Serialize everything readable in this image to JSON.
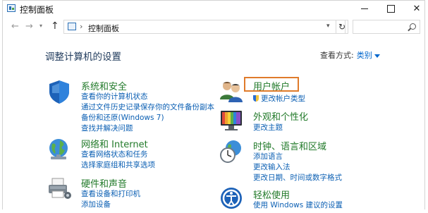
{
  "window": {
    "title": "控制面板",
    "minimize": "—",
    "maximize": "□",
    "close": "✕"
  },
  "nav": {
    "back": "←",
    "forward": "→",
    "up": "↑",
    "breadcrumb": "控制面板",
    "refresh": "↻",
    "search_placeholder": ""
  },
  "main": {
    "heading": "调整计算机的设置",
    "view_by_label": "查看方式:",
    "view_by_value": "类别"
  },
  "categories_left": [
    {
      "title": "系统和安全",
      "icon": "shield-icon",
      "links": [
        "查看你的计算机状态",
        "通过文件历史记录保存你的文件备份副本",
        "备份和还原(Windows 7)",
        "查找并解决问题"
      ]
    },
    {
      "title": "网络和 Internet",
      "icon": "network-globe-icon",
      "links": [
        "查看网络状态和任务",
        "选择家庭组和共享选项"
      ]
    },
    {
      "title": "硬件和声音",
      "icon": "printer-icon",
      "links": [
        "查看设备和打印机",
        "添加设备"
      ]
    }
  ],
  "categories_right": [
    {
      "title": "用户帐户",
      "icon": "users-icon",
      "highlighted": true,
      "highlight_color": "#e07b2b",
      "links": [
        "更改帐户类型"
      ]
    },
    {
      "title": "外观和个性化",
      "icon": "monitor-icon",
      "links": [
        "更改主题"
      ]
    },
    {
      "title": "时钟、语言和区域",
      "icon": "clock-globe-icon",
      "links": [
        "添加语言",
        "更改输入法",
        "更改日期、时间或数字格式"
      ]
    },
    {
      "title": "轻松使用",
      "icon": "ease-of-access-icon",
      "links": [
        "使用 Windows 建议的设置"
      ]
    }
  ],
  "colors": {
    "title_green": "#227a2a",
    "link_blue": "#0b5fb3",
    "heading": "#1e395b",
    "highlight": "#e07b2b"
  }
}
